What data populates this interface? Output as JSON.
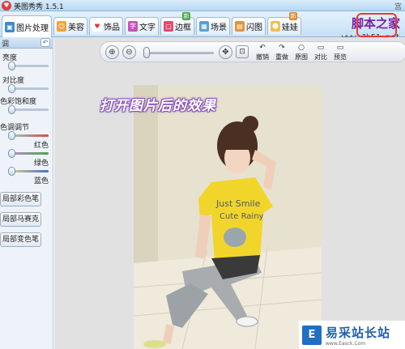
{
  "window": {
    "title": "美图秀秀 1.5.1",
    "corner_text": "宫"
  },
  "tabs": [
    {
      "label": "图片处理",
      "icon": "image-icon",
      "active": true
    },
    {
      "label": "美容",
      "icon": "face-icon"
    },
    {
      "label": "饰品",
      "icon": "heart-icon"
    },
    {
      "label": "文字",
      "icon": "text-icon",
      "icon_char": "字"
    },
    {
      "label": "边框",
      "icon": "frame-icon",
      "badge": "新"
    },
    {
      "label": "场景",
      "icon": "scene-icon"
    },
    {
      "label": "闪图",
      "icon": "flash-icon"
    },
    {
      "label": "娃娃",
      "icon": "doll-icon",
      "badge": "新"
    }
  ],
  "watermark_top": {
    "line1": "脚本之家",
    "line2": "www.Jb51.net"
  },
  "left_panel": {
    "header": "调",
    "reset_icon": "undo-icon",
    "sliders": [
      {
        "label": "亮度",
        "value": 0.0
      },
      {
        "label": "对比度",
        "value": 0.0
      },
      {
        "label": "色彩饱和度",
        "value": 0.0
      }
    ],
    "color_section_label": "色调调节",
    "color_sliders": [
      {
        "label": "红色",
        "value": 0.5,
        "color": "#d94b4b"
      },
      {
        "label": "绿色",
        "value": 0.5,
        "color": "#4aa54a"
      },
      {
        "label": "蓝色",
        "value": 0.5,
        "color": "#4a6fd1"
      }
    ],
    "buttons": [
      "局部彩色笔",
      "局部马赛克",
      "局部变色笔"
    ]
  },
  "toolbar": {
    "zoom_in_icon": "zoom-in-icon",
    "zoom_out_icon": "zoom-out-icon",
    "zoom_level": 0.0,
    "fit_icon": "fit-screen-icon",
    "actual_size_icon": "actual-size-icon",
    "tools": [
      {
        "label": "撤销",
        "icon": "undo-icon",
        "glyph": "↶"
      },
      {
        "label": "重做",
        "icon": "redo-icon",
        "glyph": "↷"
      },
      {
        "label": "原图",
        "icon": "original-icon",
        "glyph": "○"
      },
      {
        "label": "对比",
        "icon": "compare-icon",
        "glyph": "▭"
      },
      {
        "label": "预览",
        "icon": "preview-icon",
        "glyph": "▭"
      }
    ]
  },
  "canvas": {
    "caption": "打开图片后的效果",
    "shirt_text_line1": "Just Smile",
    "shirt_text_line2": "Cute Rainy"
  },
  "watermark_bottom": {
    "title": "易采站长站",
    "url": "www.Easck.Com"
  }
}
